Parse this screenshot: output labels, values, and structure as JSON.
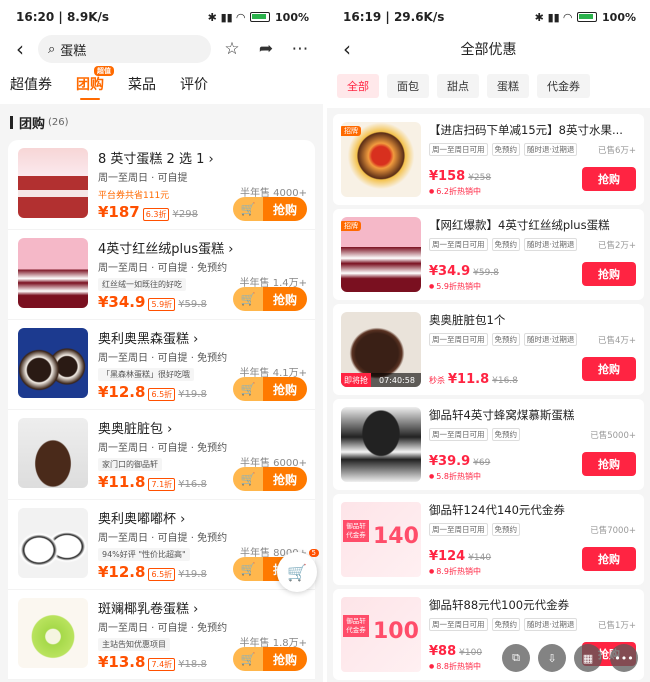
{
  "left": {
    "status": {
      "time": "16:20",
      "speed": "8.9K/s",
      "battery": "100%"
    },
    "search": {
      "text": "蛋糕"
    },
    "tabs": [
      {
        "label": "超值券"
      },
      {
        "label": "团购",
        "badge": "超值"
      },
      {
        "label": "菜品"
      },
      {
        "label": "评价"
      }
    ],
    "section": {
      "title": "团购",
      "count": "(26)"
    },
    "items": [
      {
        "title": "8 英寸蛋糕 2 选 1",
        "meta": "周一至周日 · 可自提",
        "note": "平台券共省111元",
        "note_style": "orange",
        "price": "¥187",
        "disc": "6.3折",
        "orig": "¥298",
        "sold": "半年售 4000+",
        "buy": "抢购"
      },
      {
        "title": "4英寸红丝绒plus蛋糕",
        "meta": "周一至周日 · 可自提 · 免预约",
        "note": "红丝绒一如既往的好吃",
        "price": "¥34.9",
        "disc": "5.9折",
        "orig": "¥59.8",
        "sold": "半年售 1.4万+",
        "buy": "抢购"
      },
      {
        "title": "奥利奥黑森蛋糕",
        "meta": "周一至周日 · 可自提 · 免预约",
        "note": "「黑森林蛋糕」很好吃哦",
        "price": "¥12.8",
        "disc": "6.5折",
        "orig": "¥19.8",
        "sold": "半年售 4.1万+",
        "buy": "抢购"
      },
      {
        "title": "奥奥脏脏包",
        "meta": "周一至周日 · 可自提 · 免预约",
        "note": "家门口的御品轩",
        "price": "¥11.8",
        "disc": "7.1折",
        "orig": "¥16.8",
        "sold": "半年售 6000+",
        "buy": "抢购"
      },
      {
        "title": "奥利奥嘟嘟杯",
        "meta": "周一至周日 · 可自提 · 免预约",
        "note": "94%好评 \"性价比超高\"",
        "price": "¥12.8",
        "disc": "6.5折",
        "orig": "¥19.8",
        "sold": "半年售 8000+",
        "buy": "抢购"
      },
      {
        "title": "斑斓椰乳卷蛋糕",
        "meta": "周一至周日 · 可自提 · 免预约",
        "note": "主站告知优惠项目",
        "price": "¥13.8",
        "disc": "7.4折",
        "orig": "¥18.8",
        "sold": "半年售 1.8万+",
        "buy": "抢购"
      }
    ],
    "cart_badge": "5"
  },
  "right": {
    "status": {
      "time": "16:19",
      "speed": "29.6K/s",
      "battery": "100%"
    },
    "title": "全部优惠",
    "chips": [
      "全部",
      "面包",
      "甜点",
      "蛋糕",
      "代金券"
    ],
    "items": [
      {
        "title": "【进店扫码下单减15元】8英寸水果...",
        "tags": [
          "周一至周日可用",
          "免预约",
          "随时退·过期退"
        ],
        "sold": "已售6万+",
        "price": "¥158",
        "orig": "¥258",
        "rank": "6.2折热销中",
        "buy": "抢购",
        "badge": "招牌"
      },
      {
        "title": "【网红爆款】4英寸红丝绒plus蛋糕",
        "tags": [
          "周一至周日可用",
          "免预约",
          "随时退·过期退"
        ],
        "sold": "已售2万+",
        "price": "¥34.9",
        "orig": "¥59.8",
        "rank": "5.9折热销中",
        "buy": "抢购",
        "badge": "招牌"
      },
      {
        "title": "奥奥脏脏包1个",
        "tags": [
          "周一至周日可用",
          "免预约",
          "随时退·过期退"
        ],
        "sold": "已售4万+",
        "pre": "秒杀",
        "price": "¥11.8",
        "orig": "¥16.8",
        "buy": "抢购",
        "timer_label": "即将抢",
        "timer": "07:40:58"
      },
      {
        "title": "御品轩4英寸蜂窝煤慕斯蛋糕",
        "tags": [
          "周一至周日可用",
          "免预约"
        ],
        "sold": "已售5000+",
        "price": "¥39.9",
        "orig": "¥69",
        "rank": "5.8折热销中",
        "buy": "抢购"
      },
      {
        "title": "御品轩124代140元代金券",
        "tags": [
          "周一至周日可用",
          "免预约"
        ],
        "sold": "已售7000+",
        "price": "¥124",
        "orig": "¥140",
        "rank": "8.9折热销中",
        "buy": "抢购",
        "coupon_label": "御品轩代金券",
        "coupon_amount": "140"
      },
      {
        "title": "御品轩88元代100元代金券",
        "tags": [
          "周一至周日可用",
          "免预约",
          "随时退·过期退"
        ],
        "sold": "已售1万+",
        "price": "¥88",
        "orig": "¥100",
        "rank": "8.8折热销中",
        "buy": "抢购",
        "coupon_label": "御品轩代金券",
        "coupon_amount": "100"
      }
    ]
  },
  "icons": {
    "back": "chevron-left-icon",
    "search": "search-icon",
    "star": "star-icon",
    "share": "share-icon",
    "more": "more-icon",
    "cart": "cart-icon"
  },
  "colors": {
    "accent": "#ff6a00",
    "price": "#ff5000",
    "red": "#ff2442"
  }
}
